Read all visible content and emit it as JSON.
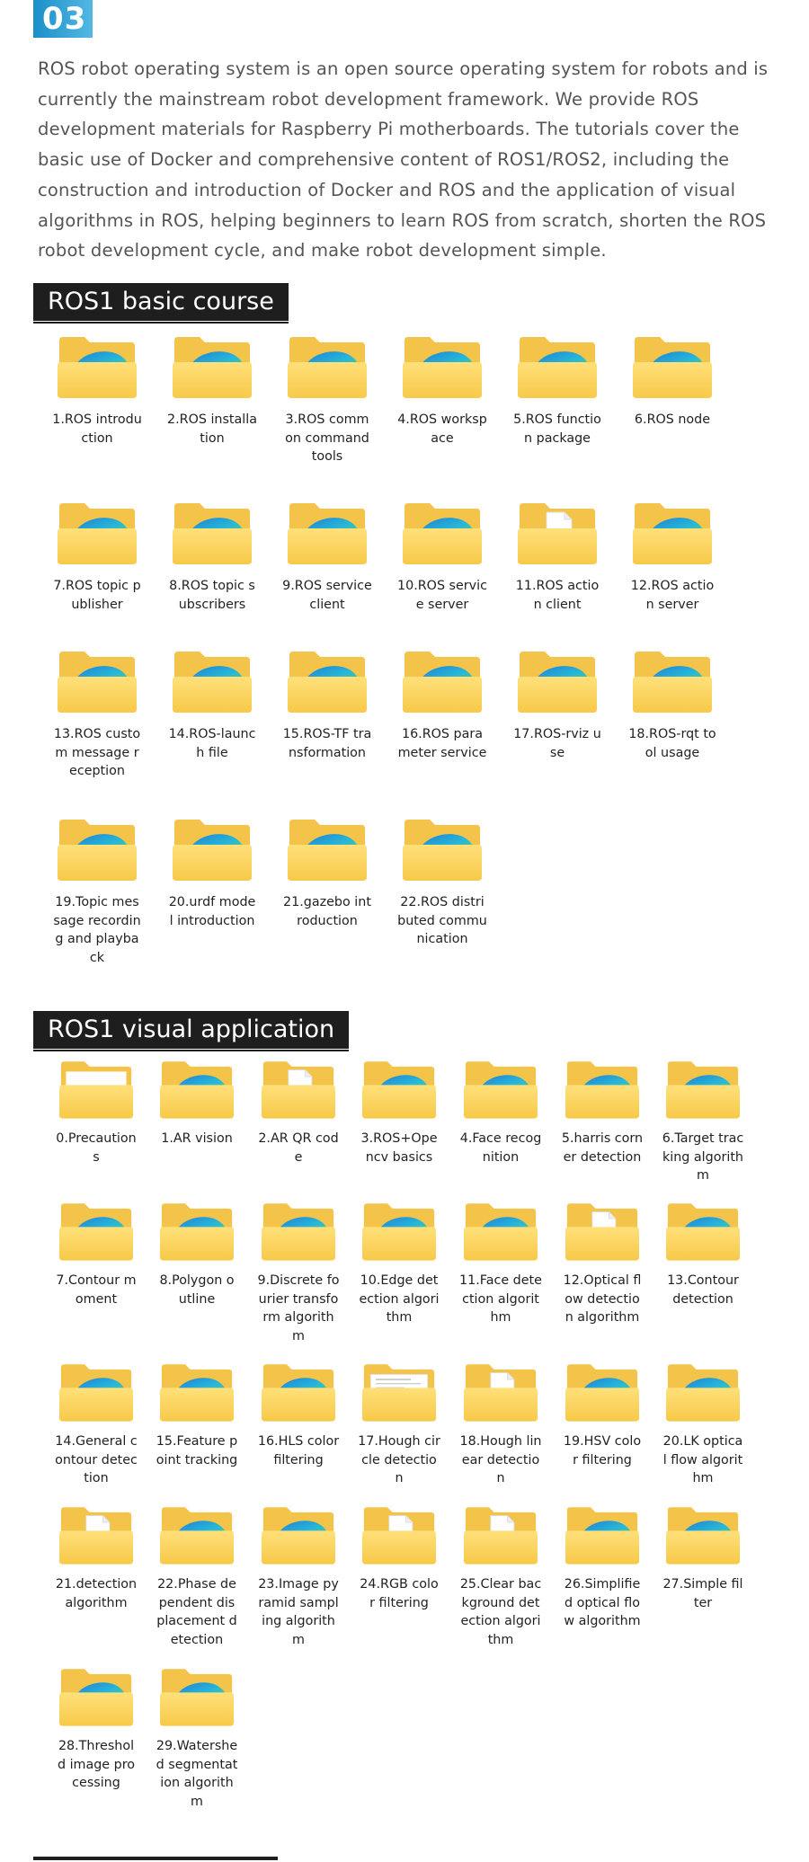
{
  "badge": "03",
  "intro": "ROS robot operating system is an open source operating system for robots and is currently the mainstream robot development framework. We provide ROS development materials for Raspberry Pi motherboards. The tutorials cover the basic use of Docker and comprehensive content of ROS1/ROS2, including the construction and introduction of Docker and ROS and the application of visual algorithms in ROS, helping beginners to learn ROS from scratch, shorten the ROS robot development cycle, and make robot development simple.",
  "sections": [
    {
      "title": "ROS1 basic course",
      "items": [
        {
          "label": "1.ROS introduction",
          "icon": "edge-folder-icon"
        },
        {
          "label": "2.ROS installation",
          "icon": "edge-folder-icon"
        },
        {
          "label": "3.ROS common command tools",
          "icon": "edge-folder-icon"
        },
        {
          "label": "4.ROS workspace",
          "icon": "edge-folder-icon"
        },
        {
          "label": "5.ROS function package",
          "icon": "edge-folder-icon"
        },
        {
          "label": "6.ROS node",
          "icon": "edge-folder-icon"
        },
        {
          "label": "7.ROS topic publisher",
          "icon": "edge-folder-icon"
        },
        {
          "label": "8.ROS topic subscribers",
          "icon": "edge-folder-icon"
        },
        {
          "label": "9.ROS service client",
          "icon": "edge-folder-icon"
        },
        {
          "label": "10.ROS service server",
          "icon": "edge-folder-icon"
        },
        {
          "label": "11.ROS action client",
          "icon": "document-folder-icon"
        },
        {
          "label": "12.ROS action server",
          "icon": "edge-folder-icon"
        },
        {
          "label": "13.ROS custom message reception",
          "icon": "edge-folder-icon"
        },
        {
          "label": "14.ROS-launch file",
          "icon": "edge-folder-icon"
        },
        {
          "label": "15.ROS-TF transformation",
          "icon": "edge-folder-icon"
        },
        {
          "label": "16.ROS parameter service",
          "icon": "edge-folder-icon"
        },
        {
          "label": "17.ROS-rviz use",
          "icon": "edge-folder-icon"
        },
        {
          "label": "18.ROS-rqt tool usage",
          "icon": "edge-folder-icon"
        },
        {
          "label": "19.Topic message recording and playback",
          "icon": "edge-folder-icon"
        },
        {
          "label": "20.urdf model introduction",
          "icon": "edge-folder-icon"
        },
        {
          "label": "21.gazebo introduction",
          "icon": "edge-folder-icon"
        },
        {
          "label": "22.ROS distributed communication",
          "icon": "edge-folder-icon"
        }
      ]
    },
    {
      "title": "ROS1 visual application",
      "items": [
        {
          "label": "0.Precautions",
          "icon": "blank-folder-icon"
        },
        {
          "label": "1.AR vision",
          "icon": "edge-folder-icon"
        },
        {
          "label": "2.AR QR code",
          "icon": "document-folder-icon"
        },
        {
          "label": "3.ROS+Opencv basics",
          "icon": "edge-folder-icon"
        },
        {
          "label": "4.Face recognition",
          "icon": "edge-folder-icon"
        },
        {
          "label": "5.harris corner detection",
          "icon": "edge-folder-icon"
        },
        {
          "label": "6.Target tracking algorithm",
          "icon": "edge-folder-icon"
        },
        {
          "label": "7.Contour moment",
          "icon": "edge-folder-icon"
        },
        {
          "label": "8.Polygon outline",
          "icon": "edge-folder-icon"
        },
        {
          "label": "9.Discrete fourier transform algorithm",
          "icon": "edge-folder-icon"
        },
        {
          "label": "10.Edge detection algorithm",
          "icon": "edge-folder-icon"
        },
        {
          "label": "11.Face detection algorithm",
          "icon": "edge-folder-icon"
        },
        {
          "label": "12.Optical flow detection algorithm",
          "icon": "document-folder-icon"
        },
        {
          "label": "13.Contour detection",
          "icon": "edge-folder-icon"
        },
        {
          "label": "14.General contour detection",
          "icon": "edge-folder-icon"
        },
        {
          "label": "15.Feature point tracking",
          "icon": "edge-folder-icon"
        },
        {
          "label": "16.HLS color filtering",
          "icon": "edge-folder-icon"
        },
        {
          "label": "17.Hough circle detection",
          "icon": "text-document-folder-icon"
        },
        {
          "label": "18.Hough linear detection",
          "icon": "document-folder-icon"
        },
        {
          "label": "19.HSV color filtering",
          "icon": "edge-folder-icon"
        },
        {
          "label": "20.LK optical flow algorithm",
          "icon": "edge-folder-icon"
        },
        {
          "label": "21.detection algorithm",
          "icon": "document-folder-icon"
        },
        {
          "label": "22.Phase dependent displacement detection",
          "icon": "edge-folder-icon"
        },
        {
          "label": "23.Image pyramid sampling algorithm",
          "icon": "edge-folder-icon"
        },
        {
          "label": "24.RGB color filtering",
          "icon": "document-folder-icon"
        },
        {
          "label": "25.Clear background detection algorithm",
          "icon": "document-folder-icon"
        },
        {
          "label": "26.Simplified optical flow algorithm",
          "icon": "edge-folder-icon"
        },
        {
          "label": "27.Simple filter",
          "icon": "edge-folder-icon"
        },
        {
          "label": "28.Threshold image processing",
          "icon": "edge-folder-icon"
        },
        {
          "label": "29.Watershed segmentation algorithm",
          "icon": "edge-folder-icon"
        }
      ]
    }
  ]
}
